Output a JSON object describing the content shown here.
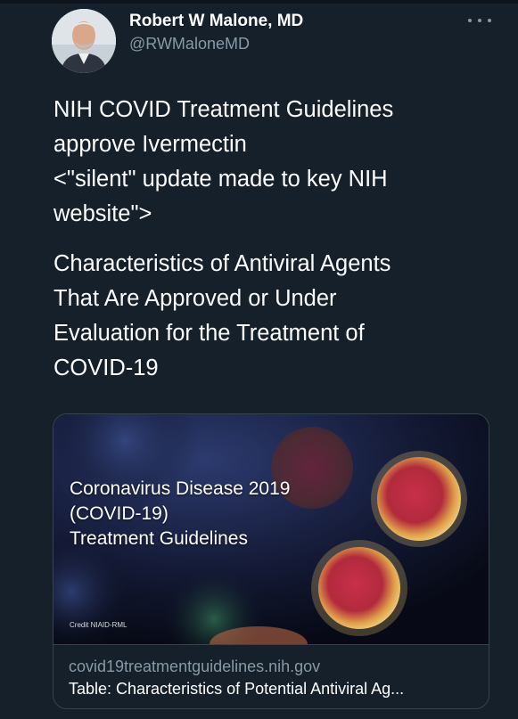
{
  "tweet": {
    "author": {
      "name": "Robert W Malone, MD",
      "handle": "@RWMaloneMD"
    },
    "text_paragraph_1": "NIH COVID Treatment Guidelines\napprove Ivermectin\n<\"silent\" update made to key NIH\nwebsite\">",
    "text_paragraph_2": "Characteristics of Antiviral Agents\nThat Are Approved or Under\nEvaluation for the Treatment of\nCOVID-19",
    "card": {
      "image_title": "Coronavirus Disease 2019\n(COVID-19)\nTreatment Guidelines",
      "image_credit": "Credit NIAID-RML",
      "domain": "covid19treatmentguidelines.nih.gov",
      "description": "Table: Characteristics of Potential Antiviral Ag..."
    }
  },
  "colors": {
    "background": "#15202b",
    "secondary_text": "#8899a6",
    "border": "#38444d"
  },
  "icons": {
    "more": "more-horizontal-icon",
    "avatar": "profile-photo"
  }
}
